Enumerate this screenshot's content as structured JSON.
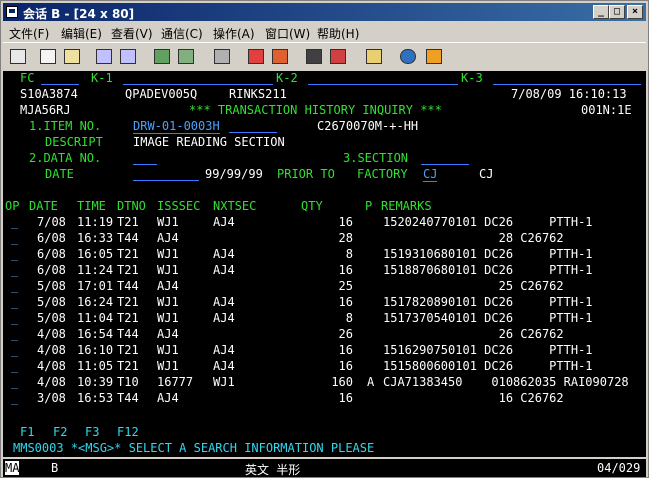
{
  "window": {
    "title": "会话 B - [24 x 80]",
    "min": "_",
    "max": "□",
    "close": "×"
  },
  "menu": [
    "文件(F)",
    "编辑(E)",
    "查看(V)",
    "通信(C)",
    "操作(A)",
    "窗口(W)",
    "帮助(H)"
  ],
  "toolbar_icons": [
    "print-icon",
    "copy-icon",
    "paste-icon",
    "send-file-icon",
    "receive-file-icon",
    "display-setup-icon",
    "keyboard-map-icon",
    "macro-icon",
    "record-macro-icon",
    "stop-macro-icon",
    "play-macro-icon",
    "pause-macro-icon",
    "clipboard-icon",
    "globe-icon",
    "help-icon"
  ],
  "screen": {
    "fkey_hdr": {
      "fc": "FC",
      "k1": "K-1",
      "k2": "K-2",
      "k3": "K-3"
    },
    "sys_id": "S10A3874",
    "job": "QPADEV005Q",
    "program": "RINKS211",
    "date_time": "7/08/09 16:10:13",
    "user": "MJA56RJ",
    "page_title": "*** TRANSACTION HISTORY INQUIRY ***",
    "page_code": "001N:1E",
    "item_no_label": "1.ITEM NO.",
    "item_no_value": "DRW-01-0003H",
    "item_code": "C2670070M-+-HH",
    "descript_label": "DESCRIPT",
    "descript_value": "IMAGE READING SECTION",
    "data_no_label": "2.DATA NO.",
    "section_label": "3.SECTION",
    "date_label": "DATE",
    "date_value": "99/99/99",
    "prior_to": "PRIOR TO",
    "factory_label": "FACTORY",
    "factory_value": "CJ",
    "factory_name": "CJ",
    "columns": {
      "op": "OP",
      "date": "DATE",
      "time": "TIME",
      "dtno": "DTNO",
      "isssec": "ISSSEC",
      "nxtsec": "NXTSEC",
      "qty": "QTY",
      "p": "P",
      "remarks": "REMARKS"
    },
    "rows": [
      {
        "op": "_",
        "date": "7/08",
        "time": "11:19",
        "dtno": "T21",
        "isssec": "WJ1",
        "nxtsec": "AJ4",
        "qty": "16",
        "p": "",
        "remarks": "1520240770101 DC26     PTTH-1"
      },
      {
        "op": "_",
        "date": "6/08",
        "time": "16:33",
        "dtno": "T44",
        "isssec": "AJ4",
        "nxtsec": "",
        "qty": "28",
        "p": "",
        "remarks": "                28 C26762"
      },
      {
        "op": "_",
        "date": "6/08",
        "time": "16:05",
        "dtno": "T21",
        "isssec": "WJ1",
        "nxtsec": "AJ4",
        "qty": "8",
        "p": "",
        "remarks": "1519310680101 DC26     PTTH-1"
      },
      {
        "op": "_",
        "date": "6/08",
        "time": "11:24",
        "dtno": "T21",
        "isssec": "WJ1",
        "nxtsec": "AJ4",
        "qty": "16",
        "p": "",
        "remarks": "1518870680101 DC26     PTTH-1"
      },
      {
        "op": "_",
        "date": "5/08",
        "time": "17:01",
        "dtno": "T44",
        "isssec": "AJ4",
        "nxtsec": "",
        "qty": "25",
        "p": "",
        "remarks": "                25 C26762"
      },
      {
        "op": "_",
        "date": "5/08",
        "time": "16:24",
        "dtno": "T21",
        "isssec": "WJ1",
        "nxtsec": "AJ4",
        "qty": "16",
        "p": "",
        "remarks": "1517820890101 DC26     PTTH-1"
      },
      {
        "op": "_",
        "date": "5/08",
        "time": "11:04",
        "dtno": "T21",
        "isssec": "WJ1",
        "nxtsec": "AJ4",
        "qty": "8",
        "p": "",
        "remarks": "1517370540101 DC26     PTTH-1"
      },
      {
        "op": "_",
        "date": "4/08",
        "time": "16:54",
        "dtno": "T44",
        "isssec": "AJ4",
        "nxtsec": "",
        "qty": "26",
        "p": "",
        "remarks": "                26 C26762"
      },
      {
        "op": "_",
        "date": "4/08",
        "time": "16:10",
        "dtno": "T21",
        "isssec": "WJ1",
        "nxtsec": "AJ4",
        "qty": "16",
        "p": "",
        "remarks": "1516290750101 DC26     PTTH-1"
      },
      {
        "op": "_",
        "date": "4/08",
        "time": "11:05",
        "dtno": "T21",
        "isssec": "WJ1",
        "nxtsec": "AJ4",
        "qty": "16",
        "p": "",
        "remarks": "1515800600101 DC26     PTTH-1"
      },
      {
        "op": "_",
        "date": "4/08",
        "time": "10:39",
        "dtno": "T10",
        "isssec": "16777",
        "nxtsec": "WJ1",
        "qty": "160",
        "p": "A",
        "remarks": "CJA71383450    010862035 RAI090728"
      },
      {
        "op": "_",
        "date": "3/08",
        "time": "16:53",
        "dtno": "T44",
        "isssec": "AJ4",
        "nxtsec": "",
        "qty": "16",
        "p": "",
        "remarks": "                16 C26762"
      }
    ],
    "fkeys": {
      "f1": "F1",
      "f2": "F2",
      "f3": "F3",
      "f12": "F12"
    },
    "message": "MMS0003 *<MSG>* SELECT A SEARCH INFORMATION PLEASE"
  },
  "status": {
    "mode": "MA",
    "session": "B",
    "ime": "英文 半形",
    "cursor": "04/029"
  }
}
